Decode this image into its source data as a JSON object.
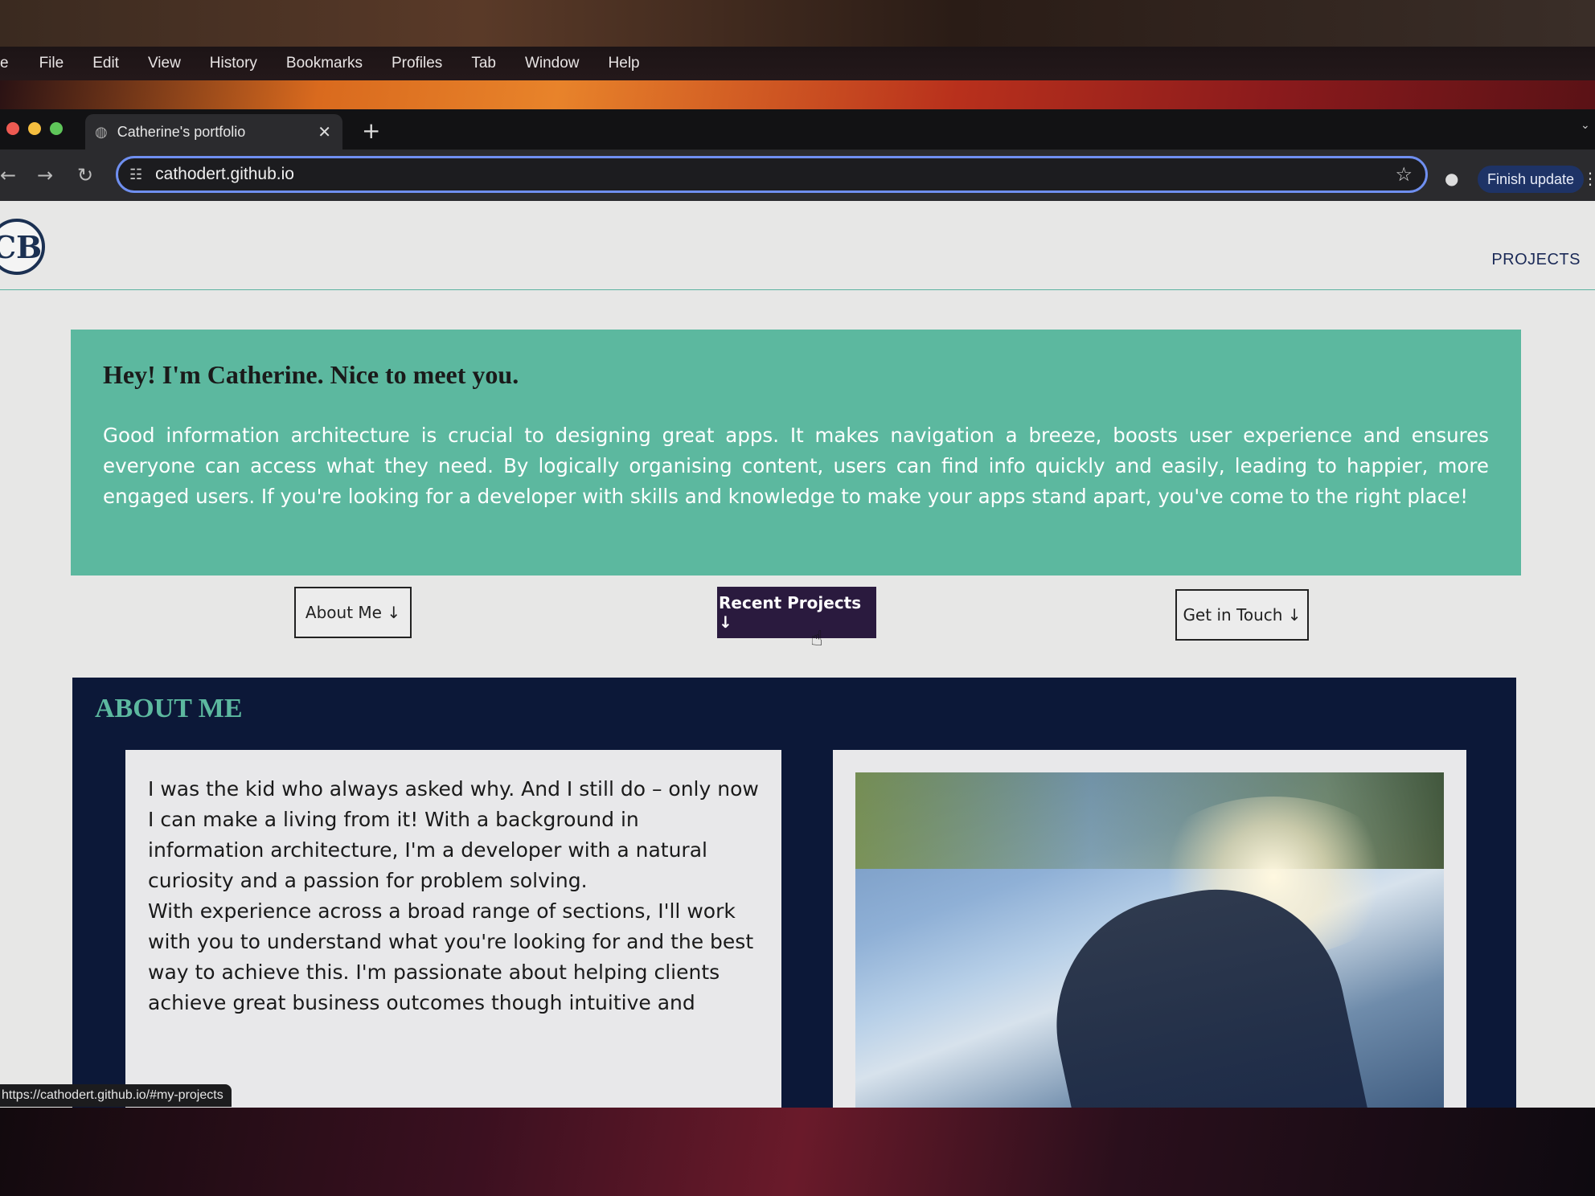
{
  "menubar": {
    "app_fragment": "e",
    "items": [
      "File",
      "Edit",
      "View",
      "History",
      "Bookmarks",
      "Profiles",
      "Tab",
      "Window",
      "Help"
    ]
  },
  "browser": {
    "tab_title": "Catherine's portfolio",
    "tab_close": "✕",
    "new_tab": "+",
    "url": "cathodert.github.io",
    "finish_update": "Finish update",
    "status_url": "https://cathodert.github.io/#my-projects"
  },
  "site": {
    "logo_text": "CB",
    "nav_projects": "PROJECTS",
    "hero": {
      "heading": "Hey! I'm Catherine. Nice to meet you.",
      "body": "Good information architecture is crucial to designing great apps. It makes navigation a breeze, boosts user experience and ensures everyone can access what they need. By logically organising content, users can find info quickly and easily, leading to happier, more engaged users. If you're looking for a developer with skills and knowledge to make your apps stand apart, you've come to the right place!"
    },
    "buttons": {
      "about": "About Me ↓",
      "projects": "Recent Projects ↓",
      "contact": "Get in Touch ↓"
    },
    "about": {
      "heading": "ABOUT ME",
      "para1": "I was the kid who always asked why. And I still do – only now I can make a living from it! With a background in information architecture, I'm a developer with a natural curiosity and a passion for problem solving.",
      "para2": "With experience across a broad range of sections, I'll work with you to understand what you're looking for and the best way to achieve this. I'm passionate about helping clients achieve great business outcomes though intuitive and"
    }
  },
  "colors": {
    "hero_bg": "#5cb89f",
    "about_bg": "#0c1838",
    "primary_button": "#2a1a3e",
    "nav_text": "#1b2a57"
  }
}
